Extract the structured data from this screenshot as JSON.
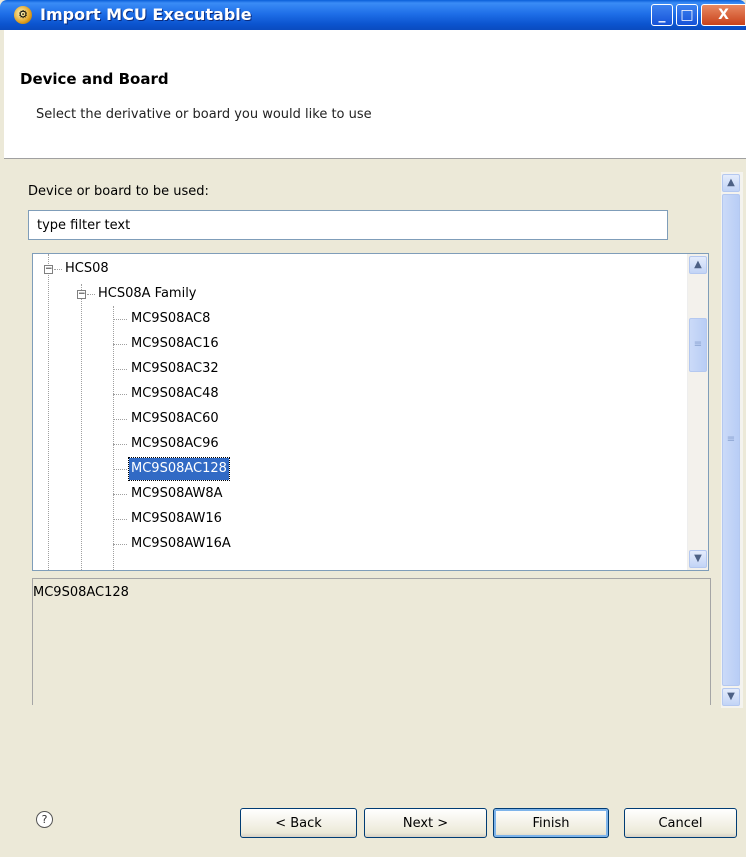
{
  "window": {
    "title": "Import MCU Executable",
    "minimize_label": "_",
    "maximize_label": "□",
    "close_label": "X"
  },
  "header": {
    "title": "Device and Board",
    "description": "Select the derivative or board you would like to use"
  },
  "form": {
    "device_label": "Device or board to be used:",
    "filter_value": "type filter text"
  },
  "tree": {
    "root": "HCS08",
    "family": "HCS08A Family",
    "items": [
      "MC9S08AC8",
      "MC9S08AC16",
      "MC9S08AC32",
      "MC9S08AC48",
      "MC9S08AC60",
      "MC9S08AC96",
      "MC9S08AC128",
      "MC9S08AW8A",
      "MC9S08AW16",
      "MC9S08AW16A"
    ],
    "selected": "MC9S08AC128"
  },
  "description_text": "MC9S08AC128",
  "buttons": {
    "help": "?",
    "back": "< Back",
    "next": "Next >",
    "finish": "Finish",
    "cancel": "Cancel"
  },
  "icons": {
    "app": "gear-icon",
    "help": "help-icon",
    "expand": "minus-box-icon",
    "scroll_up": "chevron-up-icon",
    "scroll_down": "chevron-down-icon"
  }
}
